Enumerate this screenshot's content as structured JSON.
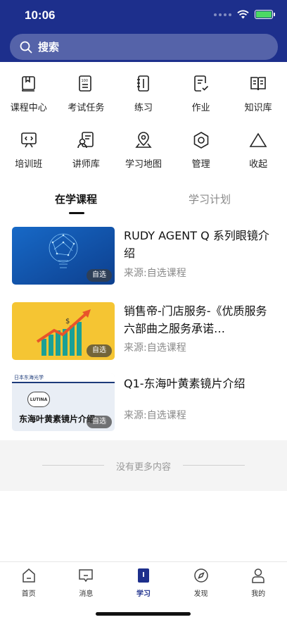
{
  "status": {
    "time": "10:06"
  },
  "search": {
    "label": "搜索"
  },
  "grid": [
    {
      "label": "课程中心",
      "icon": "course-center-icon"
    },
    {
      "label": "考试任务",
      "icon": "exam-task-icon"
    },
    {
      "label": "练习",
      "icon": "practice-icon"
    },
    {
      "label": "作业",
      "icon": "homework-icon"
    },
    {
      "label": "知识库",
      "icon": "knowledge-base-icon"
    },
    {
      "label": "培训班",
      "icon": "training-class-icon"
    },
    {
      "label": "讲师库",
      "icon": "lecturer-icon"
    },
    {
      "label": "学习地图",
      "icon": "learning-map-icon"
    },
    {
      "label": "管理",
      "icon": "manage-icon"
    },
    {
      "label": "收起",
      "icon": "collapse-icon"
    }
  ],
  "tabs": {
    "active": "在学课程",
    "inactive": "学习计划"
  },
  "courses": [
    {
      "title": "RUDY AGENT Q 系列眼镜介绍",
      "source": "来源:自选课程",
      "badge": "自选"
    },
    {
      "title": "销售帝-门店服务-《优质服务六部曲之服务承诺…",
      "source": "来源:自选课程",
      "badge": "自选"
    },
    {
      "title": "Q1-东海叶黄素镜片介绍",
      "source": "来源:自选课程",
      "badge": "自选",
      "thumb_header": "日本东海光学",
      "thumb_logo": "LUTINA",
      "thumb_caption": "东海叶黄素镜片介绍"
    }
  ],
  "no_more": "没有更多内容",
  "tabbar": [
    {
      "label": "首页",
      "icon": "home-icon"
    },
    {
      "label": "消息",
      "icon": "message-icon"
    },
    {
      "label": "学习",
      "icon": "study-icon"
    },
    {
      "label": "发现",
      "icon": "discover-icon"
    },
    {
      "label": "我的",
      "icon": "profile-icon"
    }
  ],
  "colors": {
    "header": "#1d2f8c",
    "active_tab": "#1d2f8c"
  }
}
